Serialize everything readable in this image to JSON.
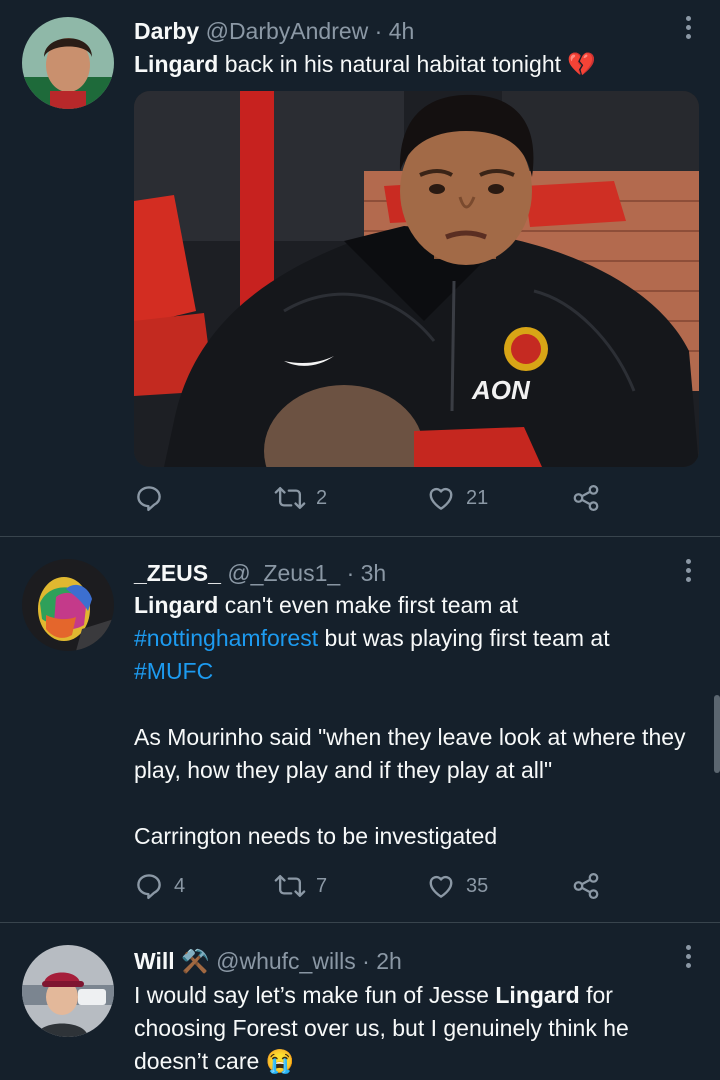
{
  "tweets": [
    {
      "name": "Darby",
      "handle": "@DarbyAndrew",
      "time": "4h",
      "text_bold": "Lingard",
      "text_rest": " back in his natural habitat tonight ",
      "emoji": "💔",
      "replies": "",
      "retweets": "2",
      "likes": "21",
      "image_logo_text": "AON"
    },
    {
      "name": "_ZEUS_",
      "handle": "@_Zeus1_",
      "time": "3h",
      "text_bold": "Lingard",
      "text_rest": " can't even make first team at ",
      "hashtag1": "#nottinghamforest",
      "text_mid": " but was playing first team at ",
      "hashtag2": "#MUFC",
      "para2": "As Mourinho said \"when they leave look at where they play, how they play and if they play at all\"",
      "para3": "Carrington needs to be investigated",
      "replies": "4",
      "retweets": "7",
      "likes": "35"
    },
    {
      "name": "Will",
      "name_emoji": "⚒️",
      "handle": "@whufc_wills",
      "time": "2h",
      "text_pre": "I would say let’s make fun of Jesse ",
      "text_bold": "Lingard",
      "text_post": " for choosing Forest over us, but I genuinely think he doesn’t care ",
      "emoji": "😭"
    }
  ],
  "separator": " · ",
  "colors": {
    "background": "#15202b",
    "secondary": "#8b98a5",
    "link": "#1d9bf0",
    "divider": "#38444d"
  },
  "icons": [
    "reply-icon",
    "retweet-icon",
    "like-icon",
    "share-icon",
    "more-icon"
  ]
}
